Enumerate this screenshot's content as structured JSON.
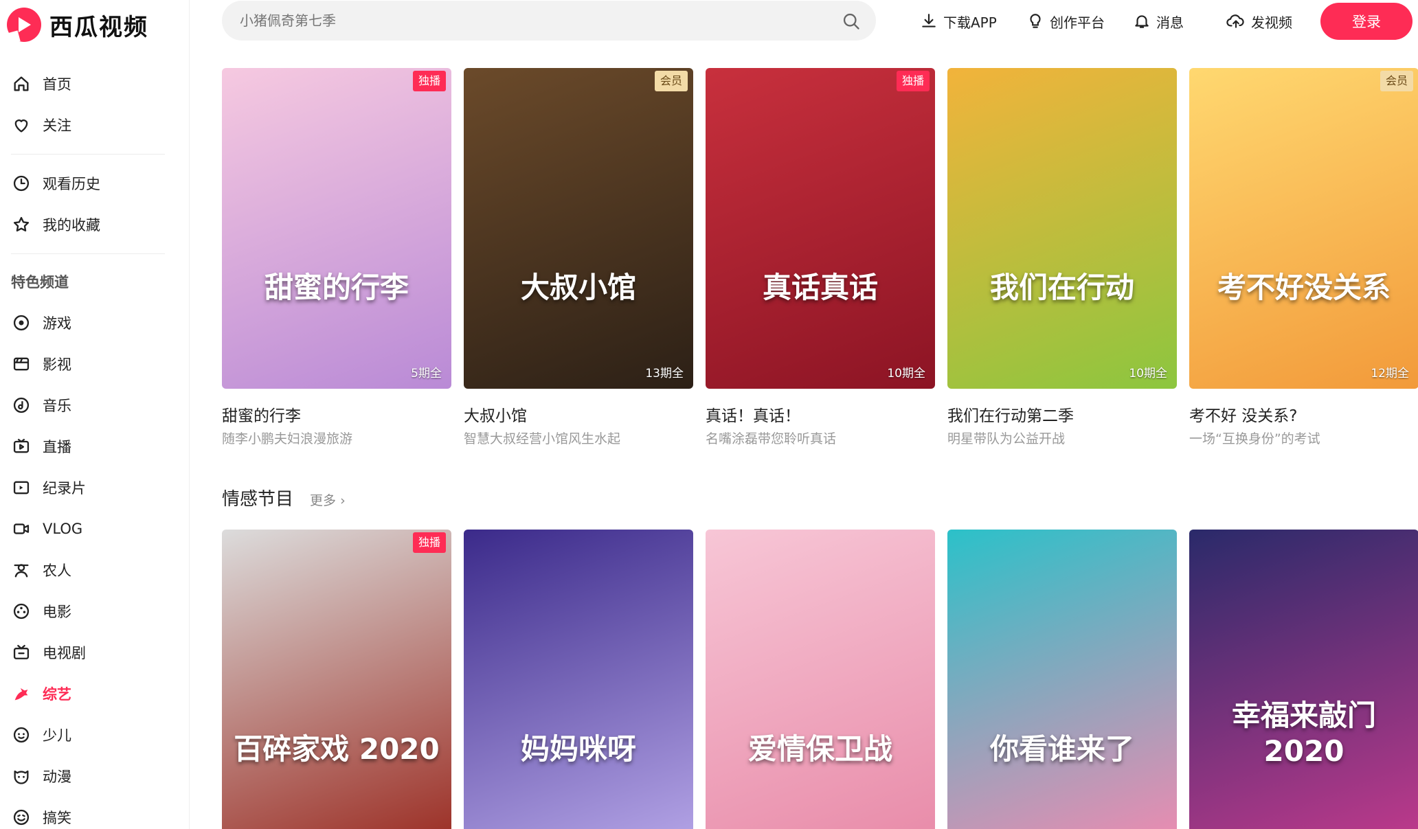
{
  "app": {
    "logo_text": "西瓜视频"
  },
  "search": {
    "placeholder": "小猪佩奇第七季"
  },
  "header": {
    "download": "下载APP",
    "creator": "创作平台",
    "messages": "消息",
    "upload": "发视频",
    "login": "登录"
  },
  "sidebar": {
    "group1": [
      {
        "label": "首页",
        "icon": "home-icon"
      },
      {
        "label": "关注",
        "icon": "heart-icon"
      }
    ],
    "group2": [
      {
        "label": "观看历史",
        "icon": "clock-icon"
      },
      {
        "label": "我的收藏",
        "icon": "star-icon"
      }
    ],
    "section_title": "特色频道",
    "channels": [
      {
        "label": "游戏",
        "icon": "game-icon"
      },
      {
        "label": "影视",
        "icon": "film-icon"
      },
      {
        "label": "音乐",
        "icon": "music-icon"
      },
      {
        "label": "直播",
        "icon": "live-icon"
      },
      {
        "label": "纪录片",
        "icon": "documentary-icon"
      },
      {
        "label": "VLOG",
        "icon": "vlog-icon"
      },
      {
        "label": "农人",
        "icon": "farmer-icon"
      },
      {
        "label": "电影",
        "icon": "movie-reel-icon"
      },
      {
        "label": "电视剧",
        "icon": "tv-icon"
      },
      {
        "label": "综艺",
        "icon": "variety-icon",
        "active": true
      },
      {
        "label": "少儿",
        "icon": "kids-icon"
      },
      {
        "label": "动漫",
        "icon": "anime-icon"
      },
      {
        "label": "搞笑",
        "icon": "funny-icon"
      }
    ]
  },
  "row1": [
    {
      "title": "甜蜜的行李",
      "subtitle": "随李小鹏夫妇浪漫旅游",
      "badge": "独播",
      "badge_type": "excl",
      "episodes": "5期全",
      "poster_text": "甜蜜的行李",
      "colors": [
        "#f6c9e0",
        "#b98ad6"
      ]
    },
    {
      "title": "大叔小馆",
      "subtitle": "智慧大叔经营小馆风生水起",
      "badge": "会员",
      "badge_type": "vip",
      "episodes": "13期全",
      "poster_text": "大叔小馆",
      "colors": [
        "#6b4a2a",
        "#2c2016"
      ]
    },
    {
      "title": "真话！真话！",
      "subtitle": "名嘴涂磊带您聆听真话",
      "badge": "独播",
      "badge_type": "excl",
      "episodes": "10期全",
      "poster_text": "真话真话",
      "colors": [
        "#c8303d",
        "#8c1424"
      ]
    },
    {
      "title": "我们在行动第二季",
      "subtitle": "明星带队为公益开战",
      "badge": "",
      "badge_type": "",
      "episodes": "10期全",
      "poster_text": "我们在行动",
      "colors": [
        "#f2b33b",
        "#8cc63f"
      ]
    },
    {
      "title": "考不好 没关系?",
      "subtitle": "一场“互换身份”的考试",
      "badge": "会员",
      "badge_type": "vip",
      "episodes": "12期全",
      "poster_text": "考不好没关系",
      "colors": [
        "#ffd870",
        "#f29a3a"
      ]
    }
  ],
  "section": {
    "title": "情感节目",
    "more": "更多"
  },
  "row2": [
    {
      "badge": "独播",
      "badge_type": "excl",
      "poster_text": "百碎家戏 2020",
      "colors": [
        "#dcdcdc",
        "#9a2a20"
      ]
    },
    {
      "badge": "",
      "badge_type": "",
      "poster_text": "妈妈咪呀",
      "colors": [
        "#3b2a8a",
        "#b6a6e8"
      ]
    },
    {
      "badge": "",
      "badge_type": "",
      "poster_text": "爱情保卫战",
      "colors": [
        "#f7c6d6",
        "#e88aa8"
      ]
    },
    {
      "badge": "",
      "badge_type": "",
      "poster_text": "你看谁来了",
      "colors": [
        "#2bc1c9",
        "#f08ab0"
      ]
    },
    {
      "badge": "",
      "badge_type": "",
      "poster_text": "幸福来敲门 2020",
      "colors": [
        "#2a2a6a",
        "#c23a8c"
      ]
    }
  ]
}
